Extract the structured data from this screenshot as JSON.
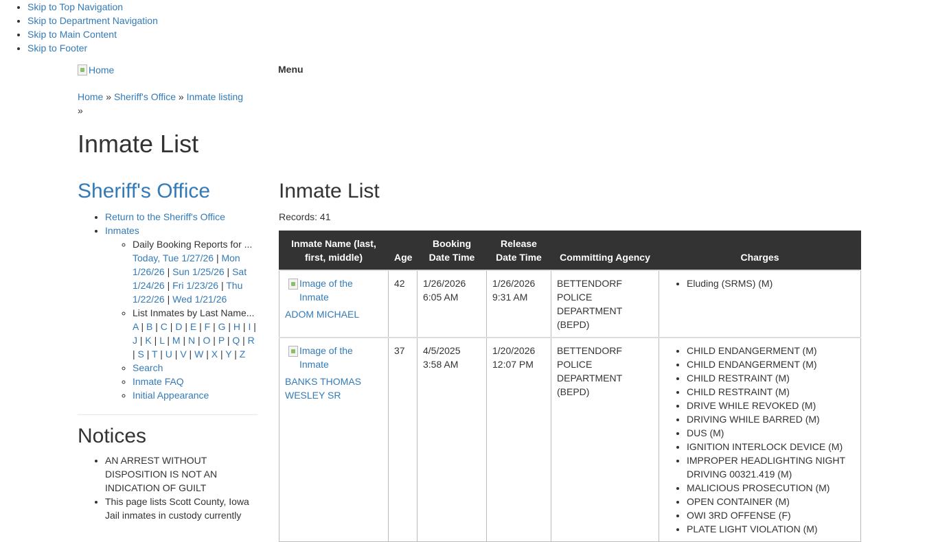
{
  "skip_links": [
    "Skip to Top Navigation",
    "Skip to Department Navigation",
    "Skip to Main Content",
    "Skip to Footer"
  ],
  "header": {
    "logo_alt": "Home",
    "menu_label": "Menu"
  },
  "breadcrumb": {
    "items": [
      "Home",
      "Sheriff's Office",
      "Inmate listing"
    ],
    "separator": "»"
  },
  "page_title": "Inmate List",
  "sidebar": {
    "title": "Sheriff's Office",
    "items": {
      "return": "Return to the Sheriff's Office",
      "inmates": "Inmates"
    },
    "daily_label": "Daily Booking Reports for ...",
    "daily_links": [
      "Today, Tue 1/27/26",
      "Mon 1/26/26",
      "Sun 1/25/26",
      "Sat 1/24/26",
      "Fri 1/23/26",
      "Thu 1/22/26",
      "Wed 1/21/26"
    ],
    "letters_label": "List Inmates by Last Name...",
    "letters": [
      "A",
      "B",
      "C",
      "D",
      "E",
      "F",
      "G",
      "H",
      "I",
      "J",
      "K",
      "L",
      "M",
      "N",
      "O",
      "P",
      "Q",
      "R",
      "S",
      "T",
      "U",
      "V",
      "W",
      "X",
      "Y",
      "Z"
    ],
    "search": "Search",
    "faq": "Inmate FAQ",
    "initial": "Initial Appearance"
  },
  "notices": {
    "title": "Notices",
    "items": [
      "AN ARREST WITHOUT DISPOSITION IS NOT AN INDICATION OF GUILT",
      "This page lists Scott County, Iowa Jail inmates in custody currently"
    ]
  },
  "main": {
    "title": "Inmate List",
    "records": "Records: 41",
    "image_alt": "Image of the Inmate",
    "columns": [
      "Inmate Name (last, first, middle)",
      "Age",
      "Booking Date Time",
      "Release Date Time",
      "Committing Agency",
      "Charges"
    ],
    "rows": [
      {
        "name": "ADOM MICHAEL",
        "age": "42",
        "booking": "1/26/2026 6:05 AM",
        "release": "1/26/2026 9:31 AM",
        "agency": "BETTENDORF POLICE DEPARTMENT (BEPD)",
        "charges": [
          "Eluding (SRMS) (M)"
        ]
      },
      {
        "name": "BANKS THOMAS WESLEY SR",
        "age": "37",
        "booking": "4/5/2025 3:58 AM",
        "release": "1/20/2026 12:07 PM",
        "agency": "BETTENDORF POLICE DEPARTMENT (BEPD)",
        "charges": [
          "CHILD ENDANGERMENT (M)",
          "CHILD ENDANGERMENT (M)",
          "CHILD RESTRAINT (M)",
          "CHILD RESTRAINT (M)",
          "DRIVE WHILE REVOKED (M)",
          "DRIVING WHILE BARRED (M)",
          "DUS (M)",
          "IGNITION INTERLOCK DEVICE (M)",
          "IMPROPER HEADLIGHTING NIGHT DRIVING 00321.419 (M)",
          "MALICIOUS PROSECUTION (M)",
          "OPEN CONTAINER (M)",
          "OWI 3RD OFFENSE (F)",
          "PLATE LIGHT VIOLATION (M)"
        ]
      }
    ]
  }
}
